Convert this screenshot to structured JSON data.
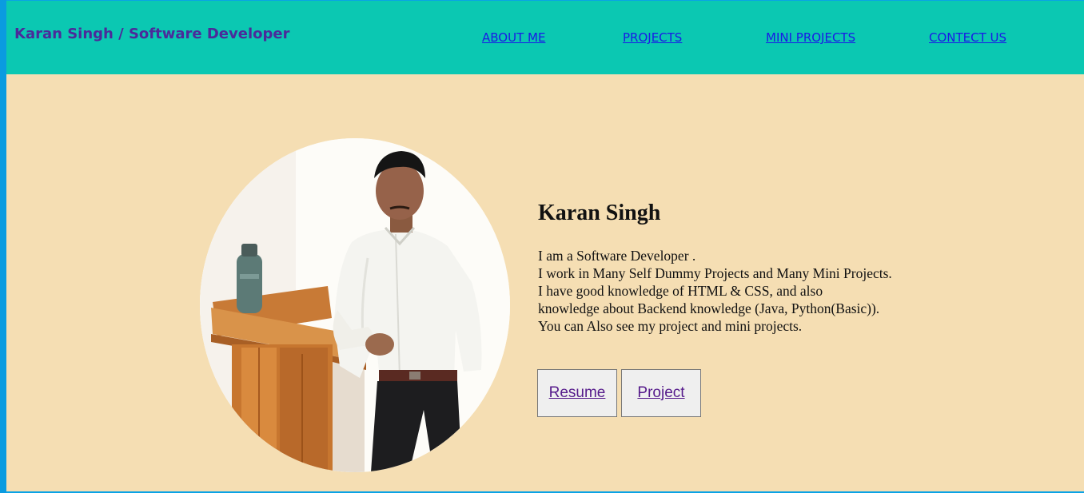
{
  "header": {
    "brand": "Karan Singh / Software Developer",
    "nav": {
      "about": "ABOUT ME",
      "projects": "PROJECTS",
      "mini_projects": "MINI PROJECTS",
      "contact": "CONTECT US"
    }
  },
  "profile": {
    "name": "Karan Singh",
    "bio": [
      "I am a Software Developer .",
      "I work in Many Self Dummy Projects and Many Mini Projects.",
      "I have good knowledge of HTML & CSS, and also",
      "knowledge about Backend knowledge (Java, Python(Basic)).",
      "You can Also see my project and mini projects."
    ],
    "buttons": {
      "resume": "Resume",
      "project": "Project"
    }
  },
  "colors": {
    "navbar": "#0bc8b2",
    "hero_background": "#f5deb3",
    "brand_text": "#4b2a9a",
    "nav_link": "#1a1ae6",
    "button_link": "#551a8b"
  },
  "icons": {
    "profile_photo": "person-portrait"
  }
}
